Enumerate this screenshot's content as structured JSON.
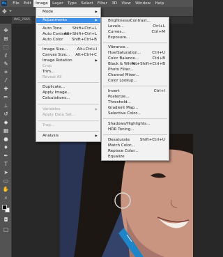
{
  "menubar": {
    "logo": "Ps",
    "items": [
      "File",
      "Edit",
      "Image",
      "Layer",
      "Type",
      "Select",
      "Filter",
      "3D",
      "View",
      "Window",
      "Help"
    ],
    "active_index": 2
  },
  "tab": {
    "title": "IMG_7665"
  },
  "image_menu": {
    "mode": "Mode",
    "adjustments": "Adjustments",
    "auto_tone": {
      "label": "Auto Tone",
      "shortcut": "Shift+Ctrl+L"
    },
    "auto_contrast": {
      "label": "Auto Contrast",
      "shortcut": "Alt+Shift+Ctrl+L"
    },
    "auto_color": {
      "label": "Auto Color",
      "shortcut": "Shift+Ctrl+B"
    },
    "image_size": {
      "label": "Image Size...",
      "shortcut": "Alt+Ctrl+I"
    },
    "canvas_size": {
      "label": "Canvas Size...",
      "shortcut": "Alt+Ctrl+C"
    },
    "image_rotation": "Image Rotation",
    "crop": "Crop",
    "trim": "Trim...",
    "reveal_all": "Reveal All",
    "duplicate": "Duplicate...",
    "apply_image": "Apply Image...",
    "calculations": "Calculations...",
    "variables": "Variables",
    "apply_data_set": "Apply Data Set...",
    "trap": "Trap...",
    "analysis": "Analysis"
  },
  "adjustments_menu": {
    "brightness_contrast": "Brightness/Contrast...",
    "levels": {
      "label": "Levels...",
      "shortcut": "Ctrl+L"
    },
    "curves": {
      "label": "Curves...",
      "shortcut": "Ctrl+M"
    },
    "exposure": "Exposure...",
    "vibrance": "Vibrance...",
    "hue_saturation": {
      "label": "Hue/Saturation...",
      "shortcut": "Ctrl+U"
    },
    "color_balance": {
      "label": "Color Balance...",
      "shortcut": "Ctrl+B"
    },
    "black_white": {
      "label": "Black & White...",
      "shortcut": "Alt+Shift+Ctrl+B"
    },
    "photo_filter": "Photo Filter...",
    "channel_mixer": "Channel Mixer...",
    "color_lookup": "Color Lookup...",
    "invert": {
      "label": "Invert",
      "shortcut": "Ctrl+I"
    },
    "posterize": "Posterize...",
    "threshold": "Threshold...",
    "gradient_map": "Gradient Map...",
    "selective_color": "Selective Color...",
    "shadows_highlights": "Shadows/Highlights...",
    "hdr_toning": "HDR Toning...",
    "desaturate": {
      "label": "Desaturate",
      "shortcut": "Shift+Ctrl+U"
    },
    "match_color": "Match Color...",
    "replace_color": "Replace Color...",
    "equalize": "Equalize"
  },
  "colors": {
    "menubar_bg": "#535353",
    "menu_bg": "#f2f2f2",
    "menu_highlight": "#3d8ee8",
    "foreground_swatch": "#0b0b0b",
    "background_swatch": "#ffffff"
  },
  "icons": {
    "tools": [
      "move-tool-icon",
      "artboard-tool-icon",
      "rectangular-marquee-icon",
      "lasso-icon",
      "quick-selection-icon",
      "crop-icon",
      "eyedropper-icon",
      "spot-healing-icon",
      "brush-icon",
      "clone-stamp-icon",
      "history-brush-icon",
      "eraser-icon",
      "gradient-icon",
      "blur-icon",
      "dodge-icon",
      "pen-icon",
      "type-icon",
      "path-selection-icon",
      "rectangle-shape-icon",
      "hand-icon",
      "zoom-icon",
      "more-tools-icon"
    ]
  }
}
